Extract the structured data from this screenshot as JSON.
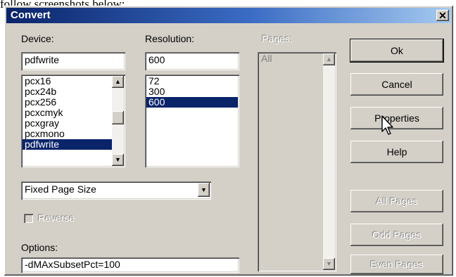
{
  "page_caption": "follow screenshots below:",
  "window": {
    "title": "Convert",
    "close_glyph": "✕"
  },
  "device": {
    "label": "Device:",
    "value": "pdfwrite",
    "items": [
      "pcx16",
      "pcx24b",
      "pcx256",
      "pcxcmyk",
      "pcxgray",
      "pcxmono",
      "pdfwrite"
    ],
    "selected_index": 6
  },
  "resolution": {
    "label": "Resolution:",
    "value": "600",
    "items": [
      "72",
      "300",
      "600"
    ],
    "selected_index": 2
  },
  "pages": {
    "label": "Pages:",
    "items": [
      "All"
    ]
  },
  "page_size": {
    "value": "Fixed Page Size"
  },
  "reverse": {
    "label": "Reverse",
    "checked": false,
    "enabled": false
  },
  "options": {
    "label": "Options:",
    "value": "-dMAxSubsetPct=100"
  },
  "buttons": {
    "ok": "Ok",
    "cancel": "Cancel",
    "properties": "Properties",
    "help": "Help",
    "all_pages": "All Pages",
    "odd_pages": "Odd Pages",
    "even_pages": "Even Pages"
  },
  "icons": {
    "scroll_up": "▲",
    "scroll_down": "▼",
    "dropdown": "▼",
    "cursor": "arrow-cursor-icon"
  },
  "colors": {
    "title_gradient_start": "#0a246a",
    "title_gradient_end": "#a6caf0",
    "selection": "#0a246a",
    "face": "#d4d0c8"
  }
}
